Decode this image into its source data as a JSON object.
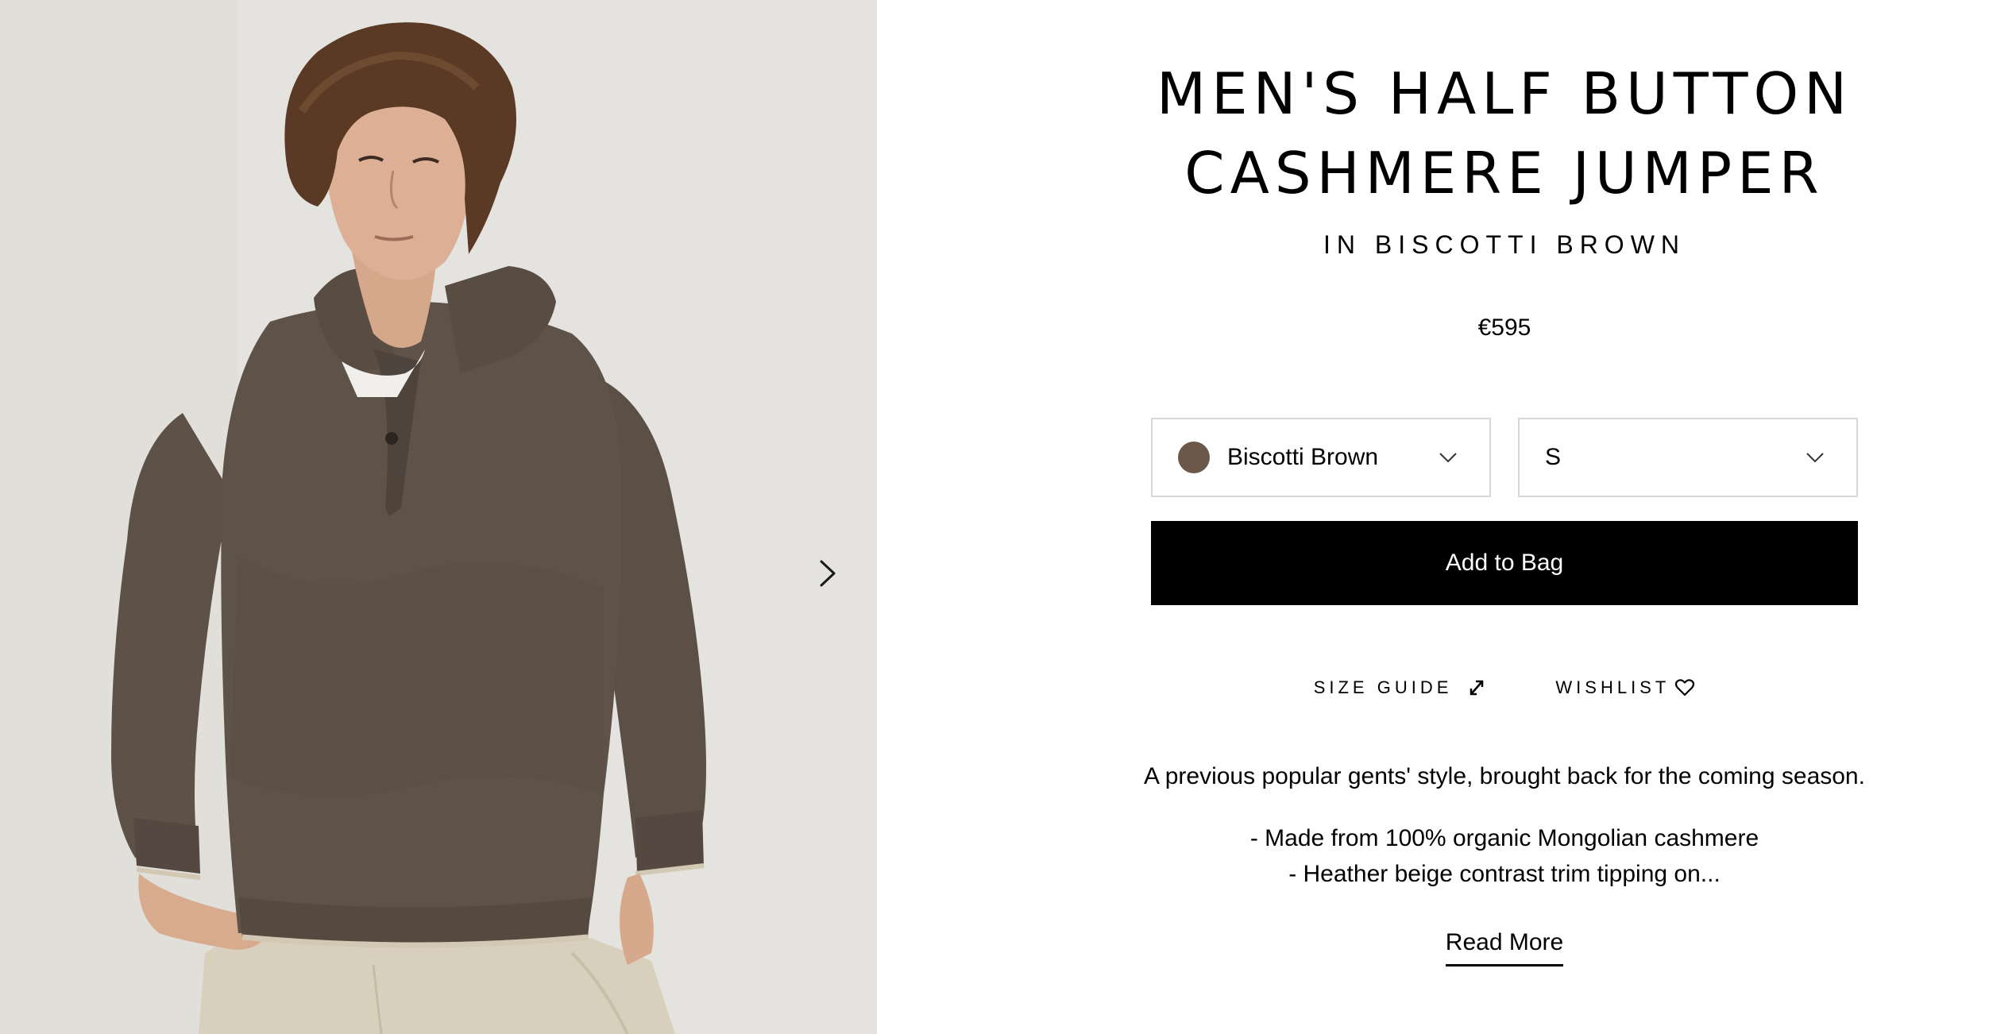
{
  "product": {
    "title_line1": "MEN'S HALF BUTTON",
    "title_line2": "CASHMERE JUMPER",
    "subtitle": "IN BISCOTTI BROWN",
    "price": "€595"
  },
  "options": {
    "color": {
      "label": "Biscotti Brown",
      "swatch_color": "#6b5849",
      "icon": "chevron-down-icon"
    },
    "size": {
      "label": "S",
      "icon": "chevron-down-icon"
    }
  },
  "actions": {
    "add_to_bag": "Add to Bag",
    "size_guide": "SIZE GUIDE",
    "wishlist": "WISHLIST",
    "read_more": "Read More"
  },
  "description": {
    "intro": "A previous popular gents' style, brought back for the coming season.",
    "bullet_1": "- Made from 100% organic Mongolian cashmere",
    "bullet_2": "- Heather beige contrast trim tipping on..."
  },
  "gallery": {
    "next_icon": "chevron-right-icon",
    "colors": {
      "background": "#e3e2de",
      "sweater": "#5e5249",
      "trim": "#d3c8b4",
      "trousers": "#d8d0bc",
      "skin": "#d9ad92",
      "hair": "#5a3a24"
    }
  }
}
